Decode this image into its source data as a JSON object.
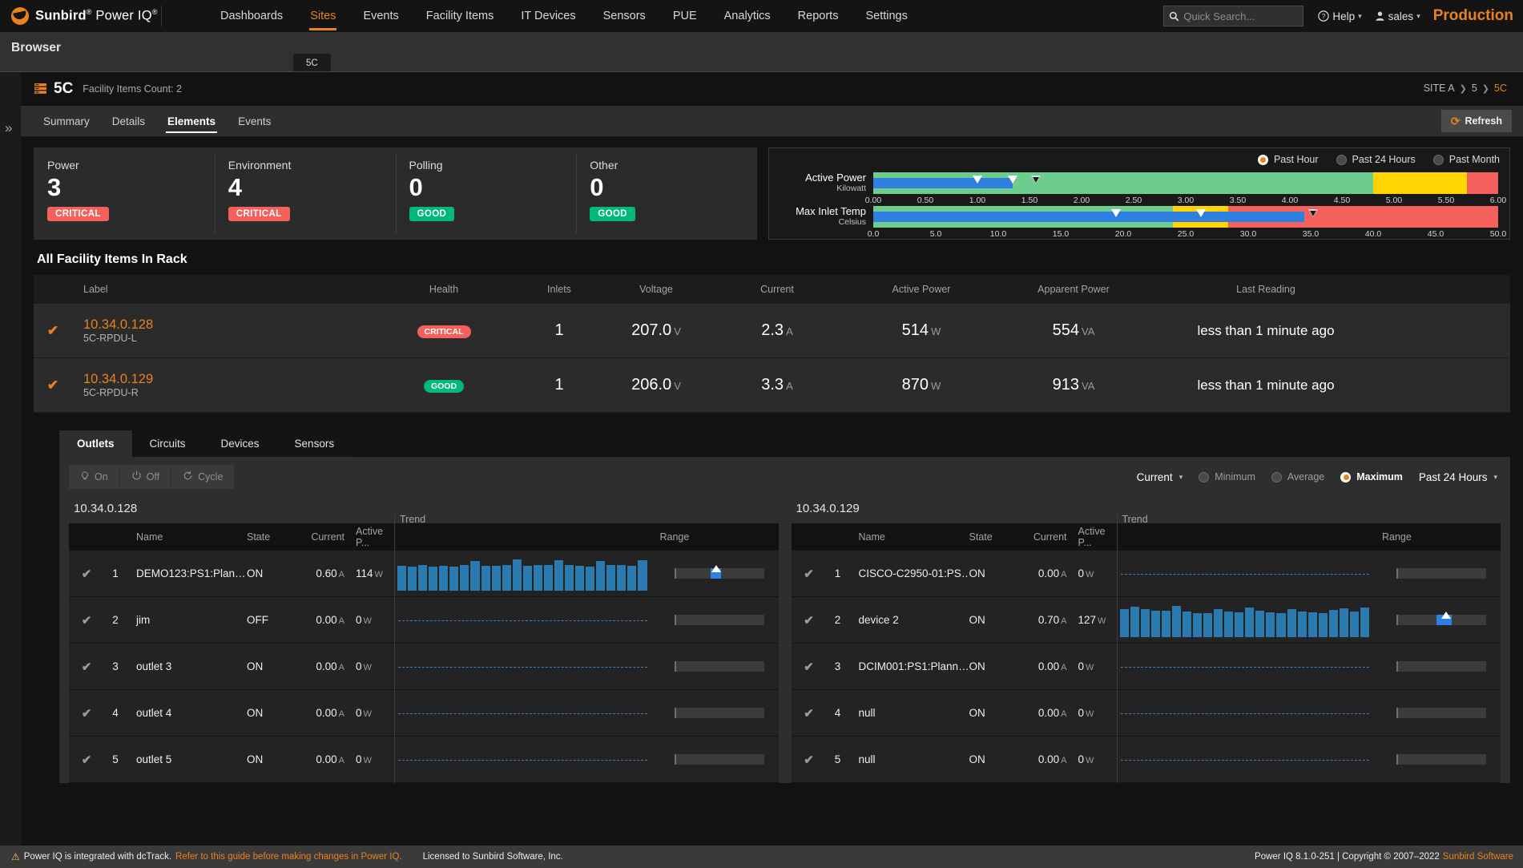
{
  "topnav": {
    "brand_bold": "Sunbird",
    "brand_reg": " Power IQ",
    "items": [
      {
        "label": "Dashboards",
        "active": false
      },
      {
        "label": "Sites",
        "active": true
      },
      {
        "label": "Events",
        "active": false
      },
      {
        "label": "Facility Items",
        "active": false
      },
      {
        "label": "IT Devices",
        "active": false
      },
      {
        "label": "Sensors",
        "active": false
      },
      {
        "label": "PUE",
        "active": false
      },
      {
        "label": "Analytics",
        "active": false
      },
      {
        "label": "Reports",
        "active": false
      },
      {
        "label": "Settings",
        "active": false
      }
    ],
    "search_placeholder": "Quick Search...",
    "help_label": "Help",
    "user_label": "sales",
    "environment_label": "Production"
  },
  "browser": {
    "label": "Browser",
    "tab_label": "5C"
  },
  "panel": {
    "title": "5C",
    "subtitle": "Facility Items Count: 2",
    "breadcrumb": [
      "SITE A",
      "5",
      "5C"
    ],
    "subtabs": [
      {
        "label": "Summary",
        "active": false
      },
      {
        "label": "Details",
        "active": false
      },
      {
        "label": "Elements",
        "active": true
      },
      {
        "label": "Events",
        "active": false
      }
    ],
    "refresh_label": "Refresh"
  },
  "status_cards": [
    {
      "name": "Power",
      "count": "3",
      "badge": "CRITICAL",
      "badge_type": "critical"
    },
    {
      "name": "Environment",
      "count": "4",
      "badge": "CRITICAL",
      "badge_type": "critical"
    },
    {
      "name": "Polling",
      "count": "0",
      "badge": "GOOD",
      "badge_type": "good"
    },
    {
      "name": "Other",
      "count": "0",
      "badge": "GOOD",
      "badge_type": "good"
    }
  ],
  "gauge_range_options": [
    {
      "label": "Past Hour",
      "selected": true
    },
    {
      "label": "Past 24 Hours",
      "selected": false
    },
    {
      "label": "Past Month",
      "selected": false
    }
  ],
  "chart_data": [
    {
      "type": "bar",
      "title": "Active Power",
      "subtitle": "Kilowatt",
      "xlabel": "",
      "ylabel": "",
      "xlim": [
        0,
        6
      ],
      "ticks": [
        "0.00",
        "0.50",
        "1.00",
        "1.50",
        "2.00",
        "2.50",
        "3.00",
        "3.50",
        "4.00",
        "4.50",
        "5.00",
        "5.50",
        "6.00"
      ],
      "tick_values": [
        0,
        0.5,
        1.0,
        1.5,
        2.0,
        2.5,
        3.0,
        3.5,
        4.0,
        4.5,
        5.0,
        5.5,
        6.0
      ],
      "bands": [
        {
          "color": "#6dcd8f",
          "from": 0,
          "to": 4.8
        },
        {
          "color": "#ffd400",
          "from": 4.8,
          "to": 5.7
        },
        {
          "color": "#f4605c",
          "from": 5.7,
          "to": 6.0
        }
      ],
      "value": 1.34,
      "markers": [
        {
          "value": 1.0,
          "style": "solid"
        },
        {
          "value": 1.34,
          "style": "solid"
        },
        {
          "value": 1.56,
          "style": "hollow"
        }
      ]
    },
    {
      "type": "bar",
      "title": "Max Inlet Temp",
      "subtitle": "Celsius",
      "xlabel": "",
      "ylabel": "",
      "xlim": [
        0,
        50
      ],
      "ticks": [
        "0.0",
        "5.0",
        "10.0",
        "15.0",
        "20.0",
        "25.0",
        "30.0",
        "35.0",
        "40.0",
        "45.0",
        "50.0"
      ],
      "tick_values": [
        0,
        5,
        10,
        15,
        20,
        25,
        30,
        35,
        40,
        45,
        50
      ],
      "bands": [
        {
          "color": "#6dcd8f",
          "from": 0,
          "to": 24.0
        },
        {
          "color": "#ffd400",
          "from": 24.0,
          "to": 28.4
        },
        {
          "color": "#f4605c",
          "from": 28.4,
          "to": 50.0
        }
      ],
      "value": 34.5,
      "markers": [
        {
          "value": 19.4,
          "style": "solid"
        },
        {
          "value": 26.2,
          "style": "solid"
        },
        {
          "value": 35.2,
          "style": "hollow"
        }
      ]
    }
  ],
  "facility_section": {
    "title": "All Facility Items In Rack",
    "columns": [
      "Label",
      "Health",
      "Inlets",
      "Voltage",
      "Current",
      "Active Power",
      "Apparent Power",
      "Last Reading"
    ],
    "rows": [
      {
        "label": "10.34.0.128",
        "sublabel": "5C-RPDU-L",
        "health": "CRITICAL",
        "health_type": "critical",
        "inlets": "1",
        "voltage": "207.0",
        "voltage_unit": "V",
        "current": "2.3",
        "current_unit": "A",
        "active_power": "514",
        "active_power_unit": "W",
        "apparent_power": "554",
        "apparent_power_unit": "VA",
        "last_reading": "less than 1 minute ago"
      },
      {
        "label": "10.34.0.129",
        "sublabel": "5C-RPDU-R",
        "health": "GOOD",
        "health_type": "good",
        "inlets": "1",
        "voltage": "206.0",
        "voltage_unit": "V",
        "current": "3.3",
        "current_unit": "A",
        "active_power": "870",
        "active_power_unit": "W",
        "apparent_power": "913",
        "apparent_power_unit": "VA",
        "last_reading": "less than 1 minute ago"
      }
    ]
  },
  "outlet_section": {
    "tabs": [
      {
        "label": "Outlets",
        "active": true
      },
      {
        "label": "Circuits",
        "active": false
      },
      {
        "label": "Devices",
        "active": false
      },
      {
        "label": "Sensors",
        "active": false
      }
    ],
    "power_buttons": [
      {
        "label": "On",
        "icon": "bulb-icon"
      },
      {
        "label": "Off",
        "icon": "power-icon"
      },
      {
        "label": "Cycle",
        "icon": "cycle-icon"
      }
    ],
    "metric_select": "Current",
    "aggregate_options": [
      {
        "label": "Minimum",
        "selected": false
      },
      {
        "label": "Average",
        "selected": false
      },
      {
        "label": "Maximum",
        "selected": true
      }
    ],
    "period_select": "Past 24 Hours",
    "columns": [
      "Name",
      "State",
      "Current",
      "Active P...",
      "Trend",
      "Range"
    ],
    "tables": [
      {
        "title": "10.34.0.128",
        "rows": [
          {
            "index": "1",
            "name": "DEMO123:PS1:Plan…",
            "state": "ON",
            "current": "0.60",
            "current_unit": "A",
            "active_power": "114",
            "active_power_unit": "W",
            "trend": [
              0.72,
              0.7,
              0.74,
              0.7,
              0.72,
              0.7,
              0.74,
              0.88,
              0.72,
              0.72,
              0.74,
              0.92,
              0.72,
              0.74,
              0.76,
              0.9,
              0.74,
              0.72,
              0.7,
              0.88,
              0.76,
              0.74,
              0.72,
              0.9
            ],
            "range_fill_start": 41,
            "range_fill_width": 11,
            "range_caret": 47
          },
          {
            "index": "2",
            "name": "jim",
            "state": "OFF",
            "current": "0.00",
            "current_unit": "A",
            "active_power": "0",
            "active_power_unit": "W",
            "trend": [],
            "range_fill_start": 0,
            "range_fill_width": 0,
            "range_caret": -1
          },
          {
            "index": "3",
            "name": "outlet 3",
            "state": "ON",
            "current": "0.00",
            "current_unit": "A",
            "active_power": "0",
            "active_power_unit": "W",
            "trend": [],
            "range_fill_start": 0,
            "range_fill_width": 0,
            "range_caret": -1
          },
          {
            "index": "4",
            "name": "outlet 4",
            "state": "ON",
            "current": "0.00",
            "current_unit": "A",
            "active_power": "0",
            "active_power_unit": "W",
            "trend": [],
            "range_fill_start": 0,
            "range_fill_width": 0,
            "range_caret": -1
          },
          {
            "index": "5",
            "name": "outlet 5",
            "state": "ON",
            "current": "0.00",
            "current_unit": "A",
            "active_power": "0",
            "active_power_unit": "W",
            "trend": [],
            "range_fill_start": 0,
            "range_fill_width": 0,
            "range_caret": -1
          }
        ]
      },
      {
        "title": "10.34.0.129",
        "rows": [
          {
            "index": "1",
            "name": "CISCO-C2950-01:PS…",
            "state": "ON",
            "current": "0.00",
            "current_unit": "A",
            "active_power": "0",
            "active_power_unit": "W",
            "trend": [],
            "range_fill_start": 0,
            "range_fill_width": 0,
            "range_caret": -1
          },
          {
            "index": "2",
            "name": "device 2",
            "state": "ON",
            "current": "0.70",
            "current_unit": "A",
            "active_power": "127",
            "active_power_unit": "W",
            "trend": [
              0.82,
              0.9,
              0.82,
              0.78,
              0.78,
              0.92,
              0.74,
              0.7,
              0.7,
              0.82,
              0.74,
              0.72,
              0.86,
              0.78,
              0.72,
              0.7,
              0.82,
              0.74,
              0.72,
              0.7,
              0.8,
              0.84,
              0.74,
              0.86
            ],
            "range_fill_start": 45,
            "range_fill_width": 17,
            "range_caret": 55
          }
        ]
      }
    ],
    "extra_rows_right": [
      {
        "index": "3",
        "name": "DCIM001:PS1:Plann…",
        "state": "ON",
        "current": "0.00",
        "current_unit": "A",
        "active_power": "0",
        "active_power_unit": "W"
      },
      {
        "index": "4",
        "name": "null",
        "state": "ON",
        "current": "0.00",
        "current_unit": "A",
        "active_power": "0",
        "active_power_unit": "W"
      },
      {
        "index": "5",
        "name": "null",
        "state": "ON",
        "current": "0.00",
        "current_unit": "A",
        "active_power": "0",
        "active_power_unit": "W"
      }
    ]
  },
  "footer": {
    "notice": "Power IQ is integrated with dcTrack.",
    "notice_link": "Refer to this guide before making changes in Power IQ.",
    "license": "Licensed to Sunbird Software, Inc.",
    "version": "Power IQ 8.1.0-251 | Copyright © 2007–2022",
    "company": "Sunbird Software"
  },
  "colors": {
    "accent": "#e8821e",
    "critical": "#f4605c",
    "good": "#00b97a",
    "blue": "#2f7fe0",
    "green_band": "#6dcd8f",
    "yellow_band": "#ffd400"
  }
}
